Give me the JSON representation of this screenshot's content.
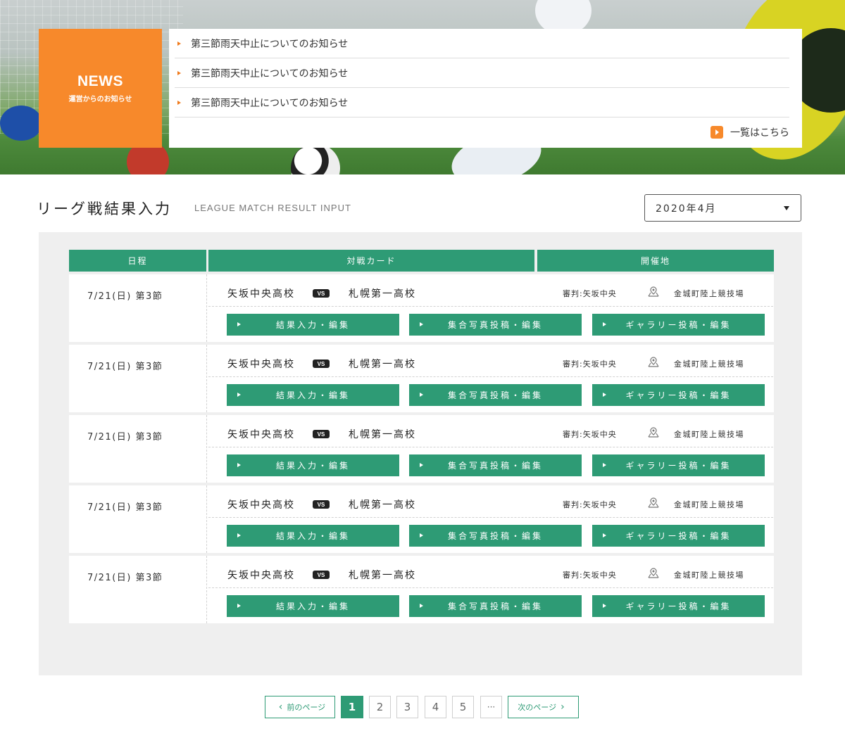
{
  "hero": {
    "image": "soccer-players-photo"
  },
  "news": {
    "badge_title": "NEWS",
    "badge_subtitle": "運営からのお知らせ",
    "items": [
      "第三節雨天中止についてのお知らせ",
      "第三節雨天中止についてのお知らせ",
      "第三節雨天中止についてのお知らせ"
    ],
    "more_label": "一覧はこちら",
    "accent": "#f7892b"
  },
  "section": {
    "title": "リーグ戦結果入力",
    "subtitle": "LEAGUE MATCH RESULT INPUT",
    "month_select": "2020年4月"
  },
  "table": {
    "headers": {
      "date": "日程",
      "card": "対戦カード",
      "venue": "開催地"
    },
    "rows": [
      {
        "date": "7/21(日) 第3節",
        "home": "矢坂中央高校",
        "vs": "VS",
        "away": "札幌第一高校",
        "referee": "審判:矢坂中央",
        "venue": "金城町陸上競技場",
        "btn_result": "結果入力・編集",
        "btn_photo": "集合写真投稿・編集",
        "btn_gallery": "ギャラリー投稿・編集"
      },
      {
        "date": "7/21(日) 第3節",
        "home": "矢坂中央高校",
        "vs": "VS",
        "away": "札幌第一高校",
        "referee": "審判:矢坂中央",
        "venue": "金城町陸上競技場",
        "btn_result": "結果入力・編集",
        "btn_photo": "集合写真投稿・編集",
        "btn_gallery": "ギャラリー投稿・編集"
      },
      {
        "date": "7/21(日) 第3節",
        "home": "矢坂中央高校",
        "vs": "VS",
        "away": "札幌第一高校",
        "referee": "審判:矢坂中央",
        "venue": "金城町陸上競技場",
        "btn_result": "結果入力・編集",
        "btn_photo": "集合写真投稿・編集",
        "btn_gallery": "ギャラリー投稿・編集"
      },
      {
        "date": "7/21(日) 第3節",
        "home": "矢坂中央高校",
        "vs": "VS",
        "away": "札幌第一高校",
        "referee": "審判:矢坂中央",
        "venue": "金城町陸上競技場",
        "btn_result": "結果入力・編集",
        "btn_photo": "集合写真投稿・編集",
        "btn_gallery": "ギャラリー投稿・編集"
      },
      {
        "date": "7/21(日) 第3節",
        "home": "矢坂中央高校",
        "vs": "VS",
        "away": "札幌第一高校",
        "referee": "審判:矢坂中央",
        "venue": "金城町陸上競技場",
        "btn_result": "結果入力・編集",
        "btn_photo": "集合写真投稿・編集",
        "btn_gallery": "ギャラリー投稿・編集"
      }
    ],
    "accent": "#2e9b75"
  },
  "pagination": {
    "prev_label": "前のページ",
    "next_label": "次のページ",
    "pages": [
      "1",
      "2",
      "3",
      "4",
      "5"
    ],
    "current": "1",
    "ellipsis": "···"
  }
}
